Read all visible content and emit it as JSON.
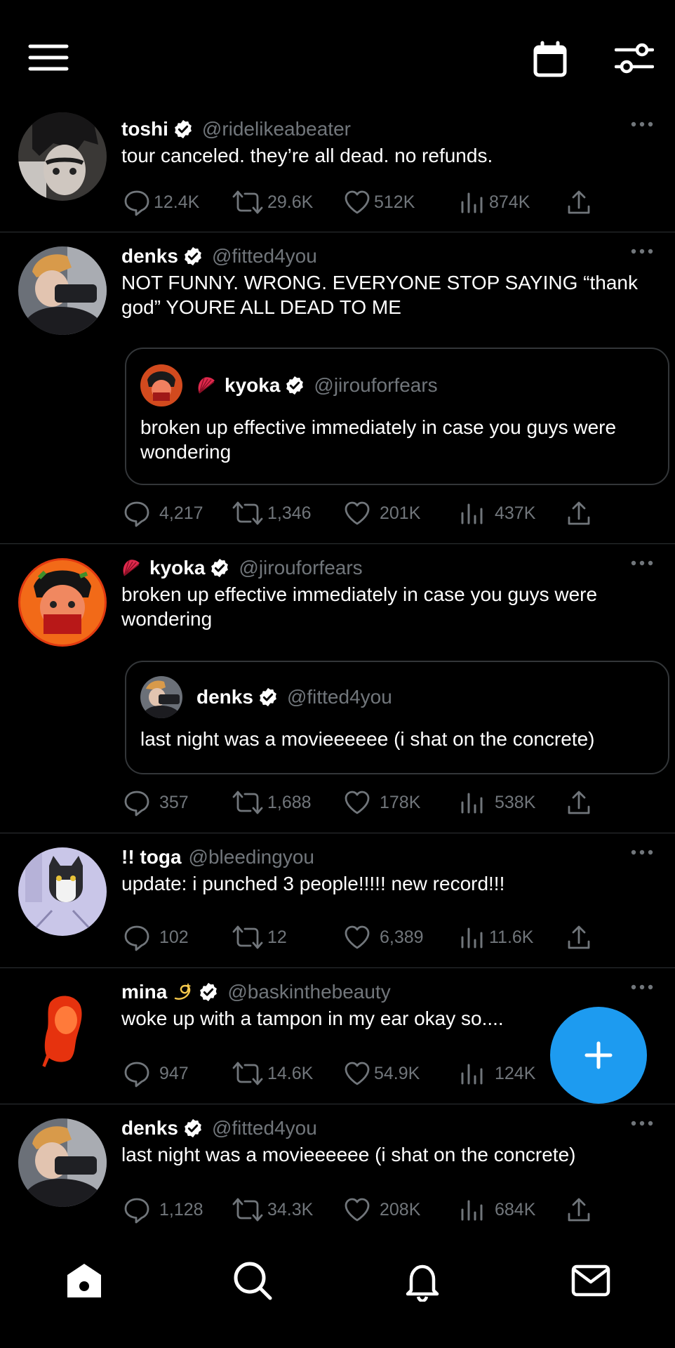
{
  "topbar": {
    "menu_icon": "menu-icon",
    "calendar_icon": "calendar-icon",
    "filter_icon": "sliders-icon"
  },
  "tweets": [
    {
      "name": "toshi",
      "handle": "@ridelikeabeater",
      "verified": true,
      "text": "tour canceled. they’re all dead. no refunds.",
      "replies": "12.4K",
      "retweets": "29.6K",
      "likes": "512K",
      "views": "874K"
    },
    {
      "name": "denks",
      "handle": "@fitted4you",
      "verified": true,
      "text": "NOT FUNNY. WRONG. EVERYONE STOP SAYING “thank god” YOURE ALL DEAD TO ME",
      "quote": {
        "name": "kyoka",
        "handle": "@jirouforfears",
        "verified": true,
        "emoji": "fan",
        "text": "broken up effective immediately in case you guys were wondering"
      },
      "replies": "4,217",
      "retweets": "1,346",
      "likes": "201K",
      "views": "437K"
    },
    {
      "name": "kyoka",
      "handle": "@jirouforfears",
      "verified": true,
      "emoji": "fan",
      "text": "broken up effective immediately in case you guys were wondering",
      "quote": {
        "name": "denks",
        "handle": "@fitted4you",
        "verified": true,
        "text": "last night was a movieeeeee (i shat on the concrete)"
      },
      "replies": "357",
      "retweets": "1,688",
      "likes": "178K",
      "views": "538K"
    },
    {
      "name": "!! toga",
      "handle": "@bleedingyou",
      "verified": false,
      "text": "update: i punched 3 people!!!!! new record!!!",
      "replies": "102",
      "retweets": "12",
      "likes": "6,389",
      "views": "11.6K"
    },
    {
      "name": "mina",
      "handle": "@baskinthebeauty",
      "verified": true,
      "emoji": "dizzy",
      "text": "woke up with a tampon in my ear okay so....",
      "replies": "947",
      "retweets": "14.6K",
      "likes": "54.9K",
      "views": "124K"
    },
    {
      "name": "denks",
      "handle": "@fitted4you",
      "verified": true,
      "text": "last night was a movieeeeee (i shat on the concrete)",
      "replies": "1,128",
      "retweets": "34.3K",
      "likes": "208K",
      "views": "684K"
    }
  ],
  "fab": {
    "icon": "plus-icon"
  },
  "bottom_nav": {
    "items": [
      "home-icon",
      "search-icon",
      "bell-icon",
      "mail-icon"
    ]
  },
  "colors": {
    "accent": "#1d9bf0",
    "muted": "#71767b",
    "divider": "#2f3336"
  }
}
